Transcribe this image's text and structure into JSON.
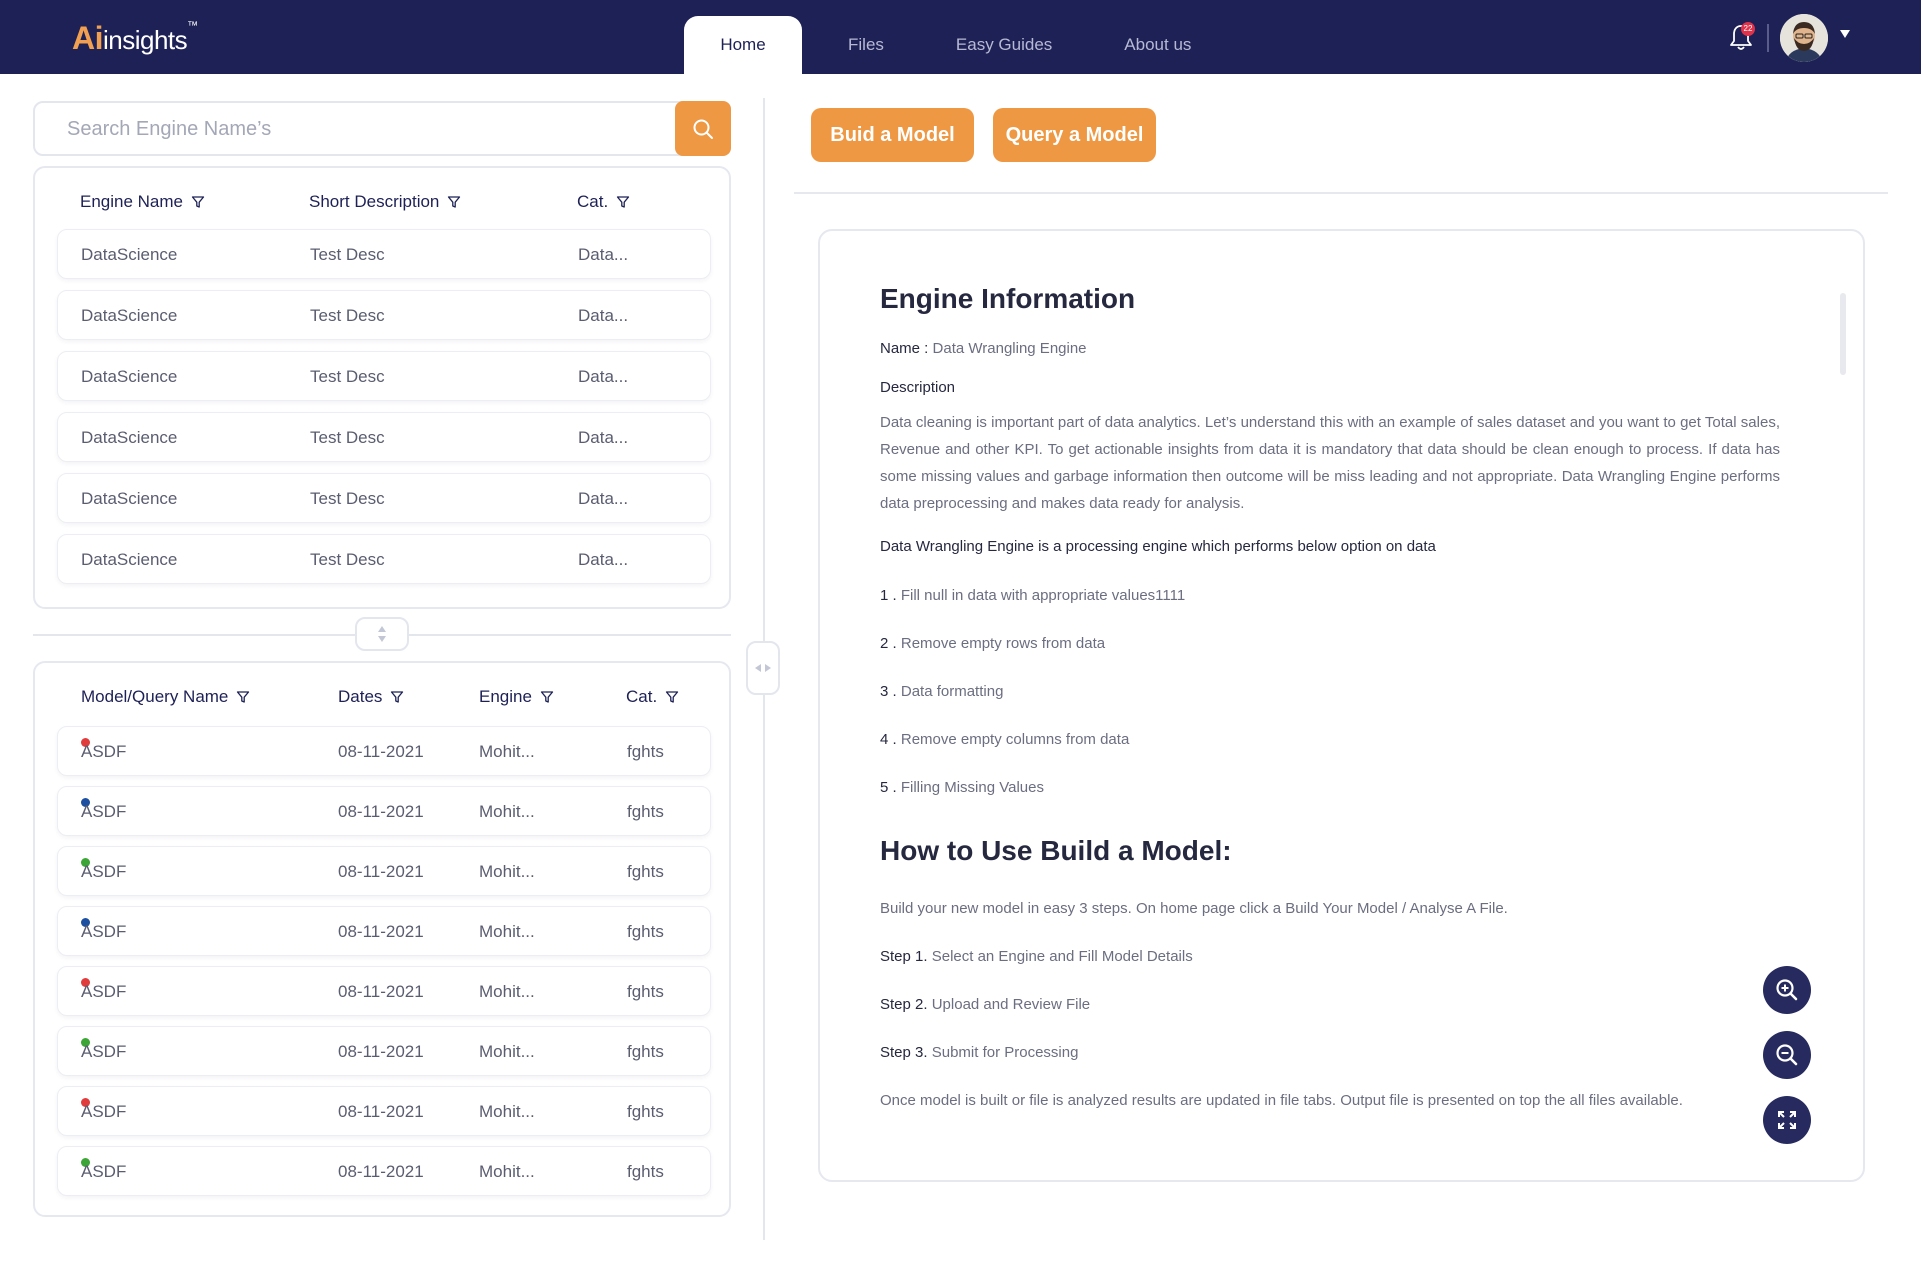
{
  "header": {
    "logo_ai": "Ai",
    "logo_rest": "insights",
    "logo_tm": "™",
    "tabs": [
      {
        "label": "Home"
      },
      {
        "label": "Files"
      },
      {
        "label": "Easy Guides"
      },
      {
        "label": "About us"
      }
    ],
    "notification_count": "22"
  },
  "search": {
    "placeholder": "Search Engine Name’s"
  },
  "engines": {
    "columns": [
      "Engine Name",
      "Short Description",
      "Cat."
    ],
    "rows": [
      {
        "name": "DataScience",
        "desc": "Test Desc",
        "cat": "Data..."
      },
      {
        "name": "DataScience",
        "desc": "Test Desc",
        "cat": "Data..."
      },
      {
        "name": "DataScience",
        "desc": "Test Desc",
        "cat": "Data..."
      },
      {
        "name": "DataScience",
        "desc": "Test Desc",
        "cat": "Data..."
      },
      {
        "name": "DataScience",
        "desc": "Test Desc",
        "cat": "Data..."
      },
      {
        "name": "DataScience",
        "desc": "Test Desc",
        "cat": "Data..."
      }
    ]
  },
  "models": {
    "columns": [
      "Model/Query Name",
      "Dates",
      "Engine",
      "Cat."
    ],
    "status_colors": {
      "red": "#e23b3b",
      "blue": "#1d4fa0",
      "green": "#3ba635"
    },
    "rows": [
      {
        "name": "ASDF",
        "date": "08-11-2021",
        "engine": "Mohit...",
        "cat": "fghts",
        "status": "red"
      },
      {
        "name": "ASDF",
        "date": "08-11-2021",
        "engine": "Mohit...",
        "cat": "fghts",
        "status": "blue"
      },
      {
        "name": "ASDF",
        "date": "08-11-2021",
        "engine": "Mohit...",
        "cat": "fghts",
        "status": "green"
      },
      {
        "name": "ASDF",
        "date": "08-11-2021",
        "engine": "Mohit...",
        "cat": "fghts",
        "status": "blue"
      },
      {
        "name": "ASDF",
        "date": "08-11-2021",
        "engine": "Mohit...",
        "cat": "fghts",
        "status": "red"
      },
      {
        "name": "ASDF",
        "date": "08-11-2021",
        "engine": "Mohit...",
        "cat": "fghts",
        "status": "green"
      },
      {
        "name": "ASDF",
        "date": "08-11-2021",
        "engine": "Mohit...",
        "cat": "fghts",
        "status": "red"
      },
      {
        "name": "ASDF",
        "date": "08-11-2021",
        "engine": "Mohit...",
        "cat": "fghts",
        "status": "green"
      }
    ]
  },
  "actions": {
    "build": "Buid a Model",
    "query": "Query a Model"
  },
  "info": {
    "title": "Engine Information",
    "name_label": "Name :",
    "name_value": "Data Wrangling Engine",
    "description_label": "Description",
    "description": "Data cleaning is important part of data analytics. Let’s understand this with an example of sales dataset and you want to get Total sales, Revenue and other KPI. To get actionable insights from data it is mandatory that data should be clean enough to process. If data has some missing values and garbage information then outcome will be miss leading and not appropriate. Data Wrangling Engine performs data preprocessing and makes data ready for analysis.",
    "processing_line": "Data Wrangling Engine is a processing engine which performs below option on data",
    "options": [
      {
        "num": "1 .",
        "text": "Fill null in data with appropriate values1111"
      },
      {
        "num": "2 .",
        "text": "Remove empty rows from data"
      },
      {
        "num": "3 .",
        "text": "Data formatting"
      },
      {
        "num": "4 .",
        "text": "Remove empty columns from data"
      },
      {
        "num": "5 .",
        "text": "Filling Missing Values"
      }
    ],
    "howto_title": "How to Use Build a Model:",
    "howto_intro": "Build your new model in easy 3 steps. On home page click a Build Your Model / Analyse A File.",
    "steps": [
      {
        "label": "Step 1.",
        "text": "Select an Engine and Fill Model Details"
      },
      {
        "label": "Step 2.",
        "text": "Upload and Review File"
      },
      {
        "label": "Step 3.",
        "text": "Submit for Processing"
      }
    ],
    "outro": "Once model is built or file is analyzed results are updated in file tabs. Output file is presented on top the all files available."
  },
  "icons": {
    "search": "search-icon",
    "bell": "bell-icon",
    "filter": "filter-icon",
    "zoom_in": "zoom-in-icon",
    "zoom_out": "zoom-out-icon",
    "fullscreen": "fullscreen-icon"
  }
}
